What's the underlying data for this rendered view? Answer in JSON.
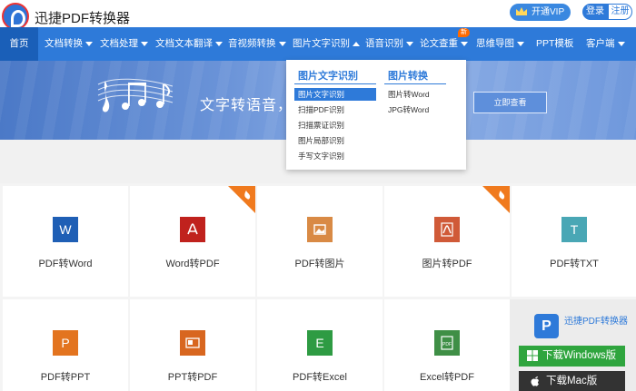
{
  "header": {
    "title": "迅捷PDF转换器",
    "vip": "开通VIP",
    "login": "登录",
    "register": "注册"
  },
  "nav": {
    "home": "首页",
    "items": [
      "文档转换",
      "文档处理",
      "文档文本翻译",
      "音视频转换",
      "图片文字识别",
      "语音识别",
      "论文查重",
      "思维导图",
      "PPT模板",
      "客户端"
    ],
    "badge": "新"
  },
  "banner": {
    "text": "文字转语音，",
    "button": "立即查看"
  },
  "dropdown": {
    "col1": {
      "title": "图片文字识别",
      "items": [
        "图片文字识别",
        "扫描PDF识别",
        "扫描票证识别",
        "图片局部识别",
        "手写文字识别"
      ]
    },
    "col2": {
      "title": "图片转换",
      "items": [
        "图片转Word",
        "JPG转Word"
      ]
    }
  },
  "tools": [
    {
      "label": "PDF转Word",
      "glyph": "W",
      "color": "#1f5fb5",
      "hot": false
    },
    {
      "label": "Word转PDF",
      "glyph": "⅄",
      "color": "#c0221d",
      "hot": true
    },
    {
      "label": "PDF转图片",
      "glyph": "▧",
      "color": "#d98a45",
      "hot": false
    },
    {
      "label": "图片转PDF",
      "glyph": "⅄",
      "color": "#d05a38",
      "hot": true
    },
    {
      "label": "PDF转TXT",
      "glyph": "T",
      "color": "#49a7b5",
      "hot": false
    },
    {
      "label": "PDF转PPT",
      "glyph": "P",
      "color": "#e3741f",
      "hot": false
    },
    {
      "label": "PPT转PDF",
      "glyph": "▤",
      "color": "#d8661f",
      "hot": false
    },
    {
      "label": "PDF转Excel",
      "glyph": "E",
      "color": "#2e9b43",
      "hot": false
    },
    {
      "label": "Excel转PDF",
      "glyph": "▦",
      "color": "#3f8f46",
      "hot": false
    }
  ],
  "download": {
    "logo": "P",
    "name": "迅捷PDF转换器",
    "windows": "下载Windows版",
    "mac": "下载Mac版"
  },
  "colors": {
    "primary": "#2e7ad9",
    "active_nav": "#1a5fb8",
    "hot": "#f07a1e"
  }
}
